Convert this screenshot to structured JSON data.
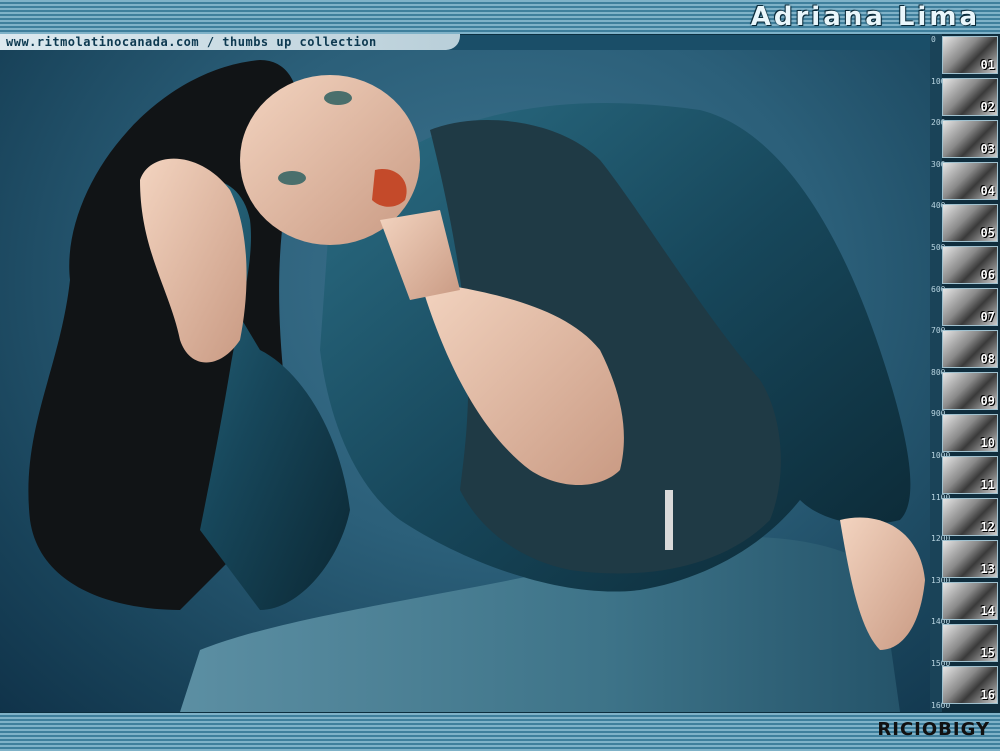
{
  "header": {
    "title": "Adriana Lima"
  },
  "url_strip": {
    "text": "www.ritmolatinocanada.com / thumbs up collection"
  },
  "sidebar": {
    "ruler_labels": [
      "0",
      "100",
      "200",
      "300",
      "400",
      "500",
      "600",
      "700",
      "800",
      "900",
      "1000",
      "1100",
      "1200",
      "1300",
      "1400",
      "1500",
      "1600"
    ],
    "thumbnails": [
      "01",
      "02",
      "03",
      "04",
      "05",
      "06",
      "07",
      "08",
      "09",
      "10",
      "11",
      "12",
      "13",
      "14",
      "15",
      "16"
    ]
  },
  "footer": {
    "signature": "RICIOBIGY"
  }
}
